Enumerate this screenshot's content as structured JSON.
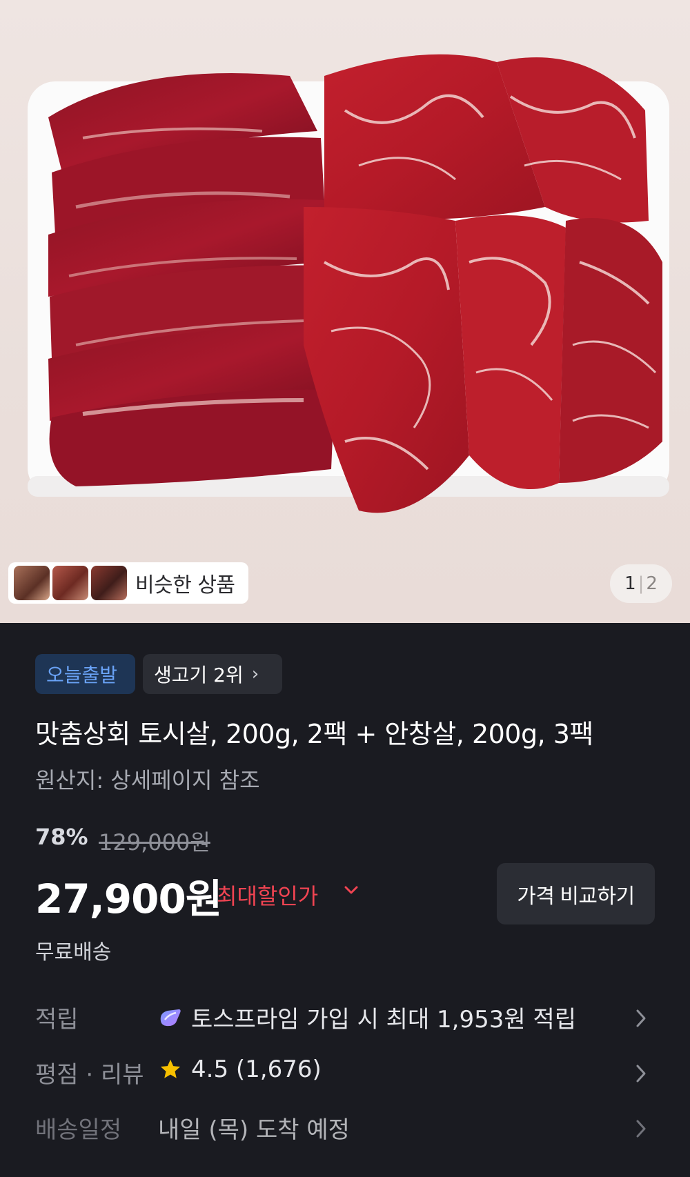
{
  "product_image": {
    "similar_products_label": "비슷한 상품",
    "pager": {
      "current": "1",
      "separator": "|",
      "total": "2"
    }
  },
  "tags": {
    "delivery_badge": "오늘출발",
    "ranking_badge": "생고기 2위"
  },
  "product": {
    "title": "맛춤상회 토시살, 200g, 2팩 + 안창살, 200g, 3팩",
    "origin": "원산지: 상세페이지 참조"
  },
  "pricing": {
    "discount_rate": "78%",
    "original_price": "129,000원",
    "price": "27,900원",
    "max_discount_label": "최대할인가",
    "compare_button": "가격 비교하기",
    "shipping": "무료배송"
  },
  "info_rows": {
    "points": {
      "label": "적립",
      "value": "토스프라임 가입 시 최대 1,953원 적립"
    },
    "rating": {
      "label": "평점 · 리뷰",
      "value": "4.5 (1,676)"
    },
    "delivery": {
      "label": "배송일정",
      "value": "내일 (목) 도착 예정"
    }
  },
  "colors": {
    "background": "#1a1b21",
    "accent_red": "#f04452",
    "badge_blue_text": "#6aa3f7",
    "star": "#f7c000"
  },
  "icons": [
    "toss-prime-icon",
    "star-icon",
    "chevron-right-icon",
    "chevron-down-icon"
  ]
}
